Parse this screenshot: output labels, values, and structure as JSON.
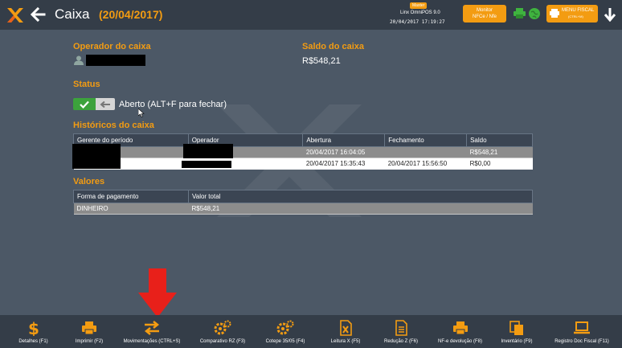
{
  "header": {
    "title": "Caixa",
    "date": "(20/04/2017)",
    "env_badge": "Master",
    "app_version": "Linx OmniPOS 9.0",
    "datetime": "20/04/2017 17:19:27",
    "monitor_button": [
      "Monitor",
      "NFCe / Nfe"
    ],
    "menu_fiscal_label": "MENU FISCAL",
    "menu_fiscal_shortcut": "(CTRL+M)",
    "accent_color": "#f39c12",
    "icons": [
      "linx-logo-icon",
      "back-arrow-icon",
      "printer-icon",
      "globe-icon",
      "down-arrow-icon"
    ]
  },
  "operator": {
    "label": "Operador do caixa",
    "name_redacted": true
  },
  "balance": {
    "label": "Saldo do caixa",
    "value": "R$548,21"
  },
  "status": {
    "label": "Status",
    "text": "Aberto (ALT+F para fechar)",
    "toggle_on": true
  },
  "history": {
    "label": "Históricos do caixa",
    "columns": [
      "Gerente do período",
      "Operador",
      "Abertura",
      "Fechamento",
      "Saldo"
    ],
    "rows": [
      {
        "gerente": "",
        "operador": "",
        "abertura": "20/04/2017 16:04:05",
        "fechamento": "",
        "saldo": "R$548,21",
        "selected": true
      },
      {
        "gerente": "",
        "operador": "",
        "abertura": "20/04/2017 15:35:43",
        "fechamento": "20/04/2017 15:56:50",
        "saldo": "R$0,00",
        "selected": false
      }
    ]
  },
  "values": {
    "label": "Valores",
    "columns": [
      "Forma de pagamento",
      "Valor total"
    ],
    "rows": [
      {
        "forma": "DINHEIRO",
        "valor": "R$548,21"
      }
    ]
  },
  "bottom_bar": [
    {
      "label": "Detalhes (F1)",
      "icon": "dollar-icon"
    },
    {
      "label": "Imprimir (F2)",
      "icon": "printer-icon"
    },
    {
      "label": "Movimentações (CTRL+S)",
      "icon": "transfer-arrows-icon"
    },
    {
      "label": "Comparativo RZ (F3)",
      "icon": "gears-icon"
    },
    {
      "label": "Cotepe 35/05 (F4)",
      "icon": "gears-icon"
    },
    {
      "label": "Leitura X (F5)",
      "icon": "excel-file-icon"
    },
    {
      "label": "Redução Z (F6)",
      "icon": "document-icon"
    },
    {
      "label": "NF-e devolução (F8)",
      "icon": "printer-icon"
    },
    {
      "label": "Inventário (F9)",
      "icon": "files-icon"
    },
    {
      "label": "Registro Doc Fiscal (F11)",
      "icon": "laptop-icon"
    }
  ],
  "annotation": {
    "arrow_color": "#e8201a",
    "points_to": "Movimentações (CTRL+S)"
  }
}
